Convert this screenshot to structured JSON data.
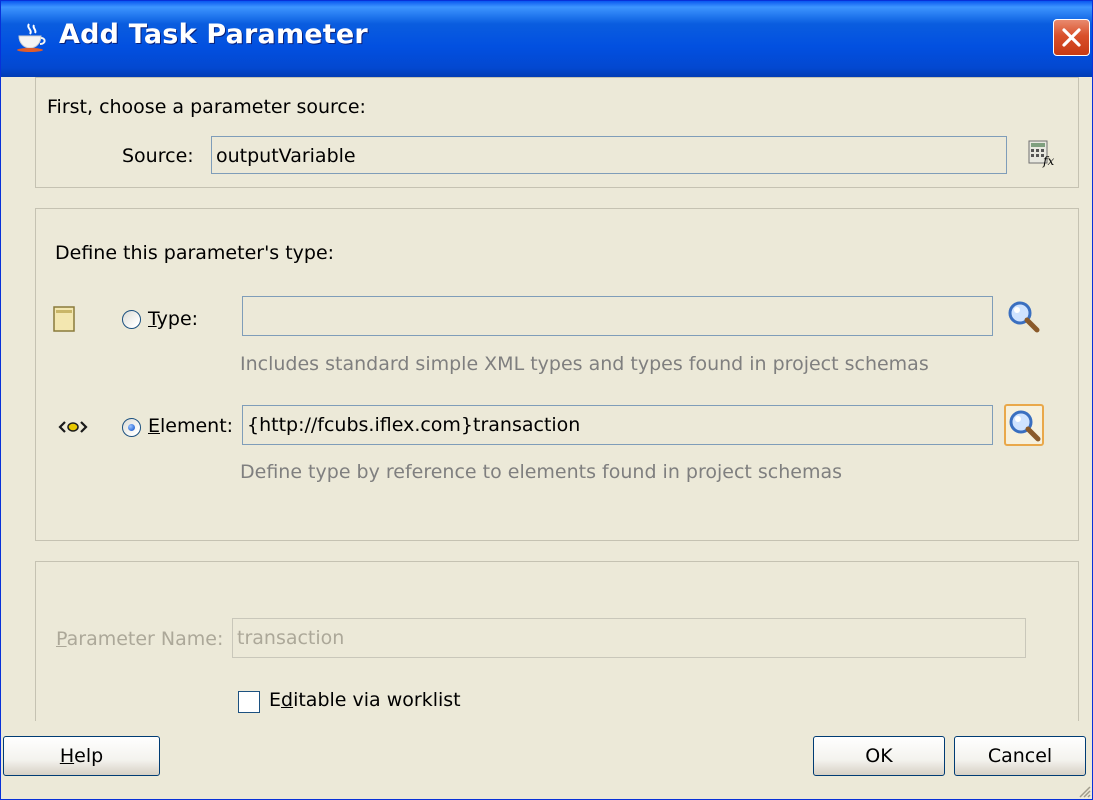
{
  "window": {
    "title": "Add Task Parameter"
  },
  "source_section": {
    "heading": "First, choose a parameter source:",
    "source_label": "Source:",
    "source_value": "outputVariable"
  },
  "type_section": {
    "heading": "Define this parameter's type:",
    "type_option": {
      "label_prefix": "",
      "label_mnemonic": "T",
      "label_rest": "ype:",
      "value": "",
      "hint": "Includes standard simple XML types and types found in project schemas",
      "selected": false
    },
    "element_option": {
      "label_mnemonic": "E",
      "label_rest": "lement:",
      "value": "{http://fcubs.iflex.com}transaction",
      "hint": "Define type by reference to elements found in project schemas",
      "selected": true
    }
  },
  "name_section": {
    "label_mnemonic": "P",
    "label_rest": "arameter Name:",
    "value": "transaction",
    "checkbox_prefix": "E",
    "checkbox_mnemonic": "d",
    "checkbox_rest": "itable via worklist",
    "checkbox_checked": false
  },
  "buttons": {
    "help_mnemonic": "H",
    "help_rest": "elp",
    "ok": "OK",
    "cancel": "Cancel"
  },
  "colors": {
    "titlebar": "#0250e0",
    "dialog_bg": "#ece9d8",
    "close_button": "#d9502b",
    "field_border": "#7f9db9",
    "hint_text": "#7f7f7f",
    "disabled_text": "#aca899"
  }
}
